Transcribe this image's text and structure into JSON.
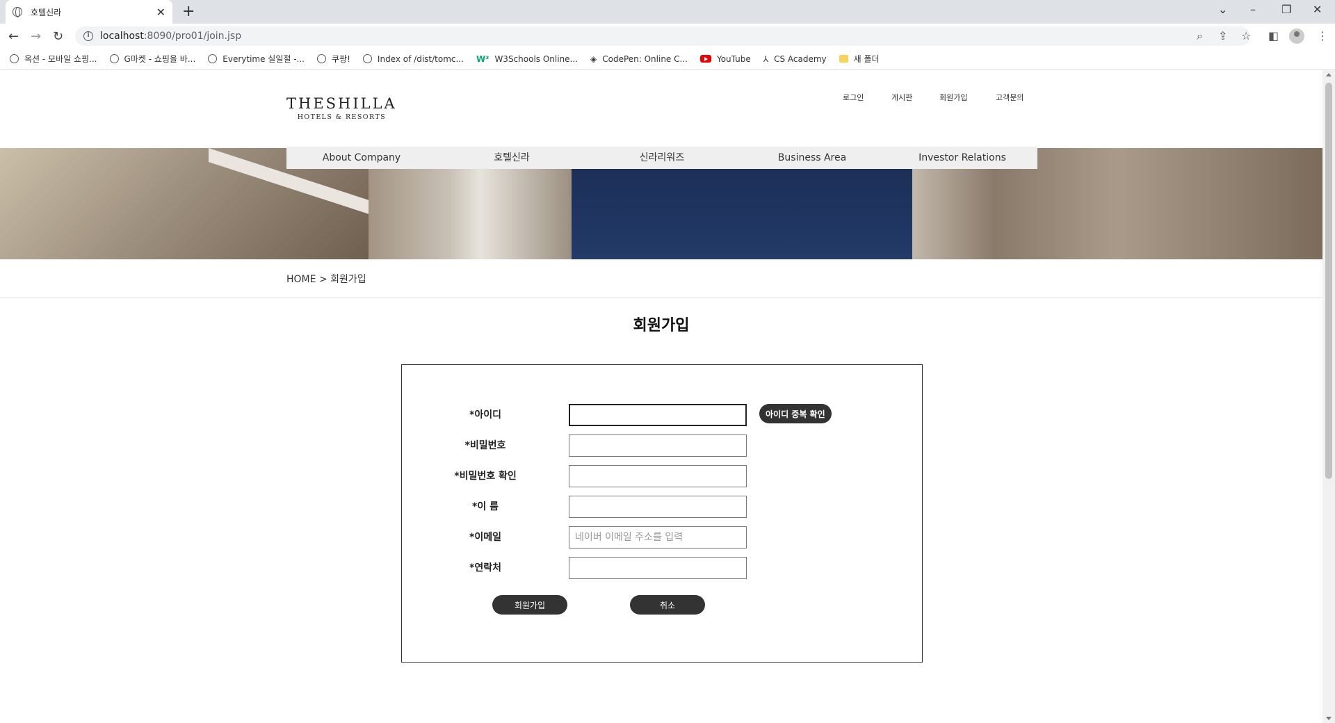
{
  "browser": {
    "tab_title": "호텔신라",
    "tab_close": "✕",
    "new_tab": "+",
    "url_host": "localhost",
    "url_path": ":8090/pro01/join.jsp",
    "bookmarks": [
      {
        "label": "옥션 - 모바일 쇼핑...",
        "icon": "globe-icon"
      },
      {
        "label": "G마켓 - 쇼핑을 바...",
        "icon": "globe-icon"
      },
      {
        "label": "Everytime 실일절 -...",
        "icon": "globe-icon"
      },
      {
        "label": "쿠팡!",
        "icon": "globe-icon"
      },
      {
        "label": "Index of /dist/tomc...",
        "icon": "globe-icon"
      },
      {
        "label": "W3Schools Online...",
        "icon": "w3schools-icon"
      },
      {
        "label": "CodePen: Online C...",
        "icon": "codepen-icon"
      },
      {
        "label": "YouTube",
        "icon": "youtube-icon"
      },
      {
        "label": "CS Academy",
        "icon": "cs-academy-icon"
      },
      {
        "label": "새 폴더",
        "icon": "folder-icon"
      }
    ]
  },
  "header": {
    "logo_line1": "THESHILLA",
    "logo_line2": "HOTELS & RESORTS",
    "top_menu": [
      "로그인",
      "게시판",
      "회원가입",
      "고객문의"
    ]
  },
  "main_nav": [
    "About Company",
    "호텔신라",
    "신라리워즈",
    "Business Area",
    "Investor Relations"
  ],
  "breadcrumb": {
    "home": "HOME",
    "sep": ">",
    "current": "회원가입"
  },
  "page_title": "회원가입",
  "form": {
    "fields": [
      {
        "label": "*아이디",
        "value": "",
        "placeholder": ""
      },
      {
        "label": "*비밀번호",
        "value": "",
        "placeholder": ""
      },
      {
        "label": "*비밀번호 확인",
        "value": "",
        "placeholder": ""
      },
      {
        "label": "*이 름",
        "value": "",
        "placeholder": ""
      },
      {
        "label": "*이메일",
        "value": "",
        "placeholder": "네이버 이메일 주소를 입력"
      },
      {
        "label": "*연락처",
        "value": "",
        "placeholder": ""
      }
    ],
    "dup_check_button": "아이디 중복 확인",
    "submit_button": "회원가입",
    "cancel_button": "취소"
  }
}
